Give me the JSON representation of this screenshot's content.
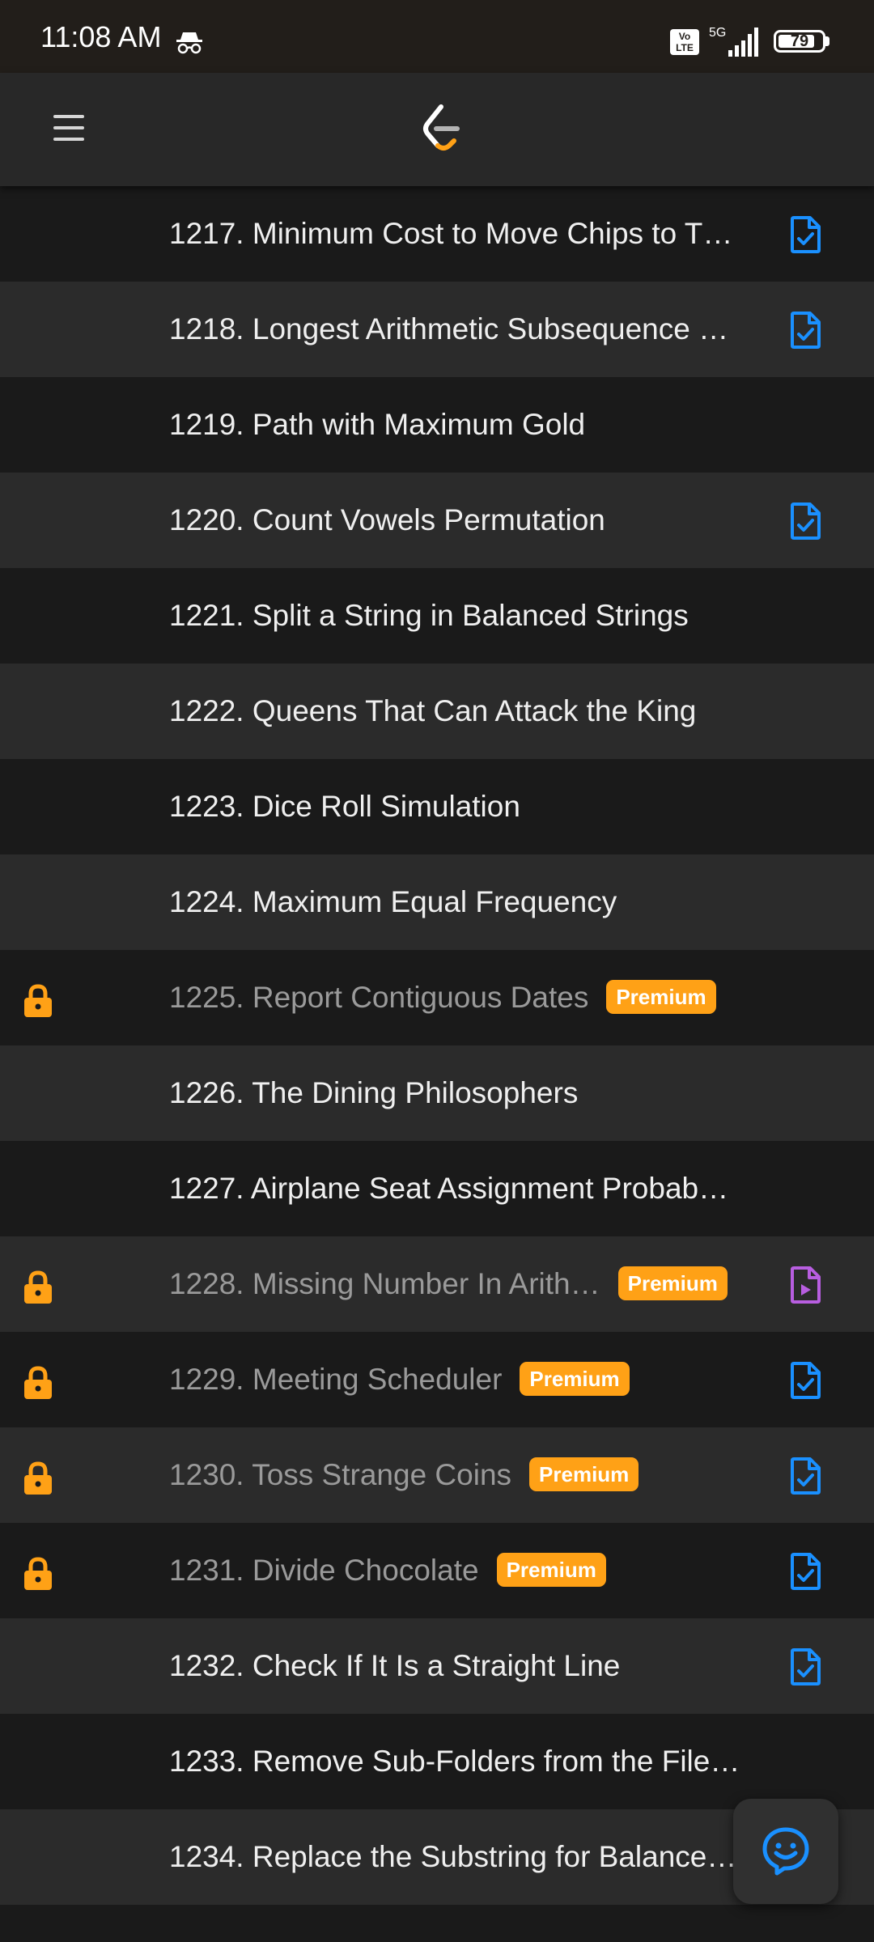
{
  "status_bar": {
    "time": "11:08 AM",
    "volte": "Vo LTE",
    "network": "5G",
    "battery": "79"
  },
  "header": {
    "menu_icon": "hamburger-menu-icon",
    "logo": "leetcode-logo"
  },
  "colors": {
    "premium": "#ffa116",
    "lock": "#ffa116",
    "solution_icon": "#1a90ff",
    "video_icon": "#b85ee0"
  },
  "problems": [
    {
      "title": "1217. Minimum Cost to Move Chips to T…",
      "locked": false,
      "premium": "",
      "icon": "solution"
    },
    {
      "title": "1218. Longest Arithmetic Subsequence …",
      "locked": false,
      "premium": "",
      "icon": "solution"
    },
    {
      "title": "1219. Path with Maximum Gold",
      "locked": false,
      "premium": "",
      "icon": ""
    },
    {
      "title": "1220. Count Vowels Permutation",
      "locked": false,
      "premium": "",
      "icon": "solution"
    },
    {
      "title": "1221. Split a String in Balanced Strings",
      "locked": false,
      "premium": "",
      "icon": ""
    },
    {
      "title": "1222. Queens That Can Attack the King",
      "locked": false,
      "premium": "",
      "icon": ""
    },
    {
      "title": "1223. Dice Roll Simulation",
      "locked": false,
      "premium": "",
      "icon": ""
    },
    {
      "title": "1224. Maximum Equal Frequency",
      "locked": false,
      "premium": "",
      "icon": ""
    },
    {
      "title": "1225. Report Contiguous Dates",
      "locked": true,
      "premium": "Premium",
      "icon": ""
    },
    {
      "title": "1226. The Dining Philosophers",
      "locked": false,
      "premium": "",
      "icon": ""
    },
    {
      "title": "1227. Airplane Seat Assignment Probab…",
      "locked": false,
      "premium": "",
      "icon": ""
    },
    {
      "title": "1228. Missing Number In Arith…",
      "locked": true,
      "premium": "Premium",
      "icon": "video"
    },
    {
      "title": "1229. Meeting Scheduler",
      "locked": true,
      "premium": "Premium",
      "icon": "solution"
    },
    {
      "title": "1230. Toss Strange Coins",
      "locked": true,
      "premium": "Premium",
      "icon": "solution"
    },
    {
      "title": "1231. Divide Chocolate",
      "locked": true,
      "premium": "Premium",
      "icon": "solution"
    },
    {
      "title": "1232. Check If It Is a Straight Line",
      "locked": false,
      "premium": "",
      "icon": "solution"
    },
    {
      "title": "1233. Remove Sub-Folders from the File…",
      "locked": false,
      "premium": "",
      "icon": ""
    },
    {
      "title": "1234. Replace the Substring for Balance…",
      "locked": false,
      "premium": "",
      "icon": ""
    }
  ],
  "fab": {
    "icon": "feedback-smiley-icon"
  }
}
